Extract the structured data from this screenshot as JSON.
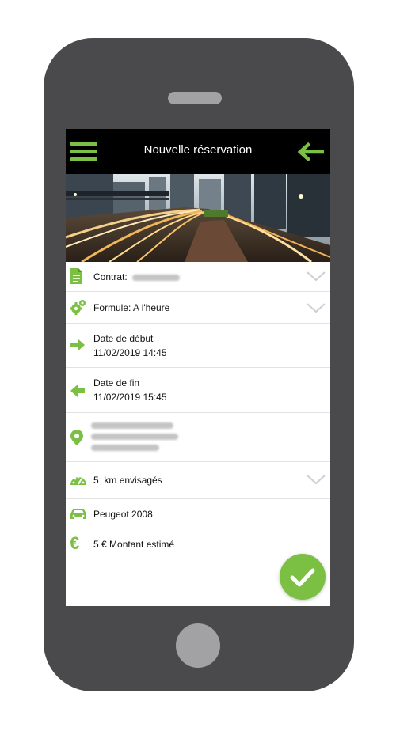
{
  "header": {
    "title": "Nouvelle réservation"
  },
  "form": {
    "contract_label": "Contrat:",
    "formula_label": "Formule:",
    "formula_value": "A l'heure",
    "start_label": "Date de début",
    "start_value": "11/02/2019 14:45",
    "end_label": "Date de fin",
    "end_value": "11/02/2019 15:45",
    "km_value": "5",
    "km_label": "km envisagés",
    "vehicle": "Peugeot 2008",
    "amount_value": "5 €",
    "amount_label": "Montant estimé"
  },
  "colors": {
    "accent": "#7bc043",
    "phone_body": "#4a4a4c",
    "appbar": "#000000"
  },
  "icons": [
    "menu-icon",
    "back-arrow-icon",
    "document-icon",
    "gears-icon",
    "arrow-right-icon",
    "arrow-left-icon",
    "location-pin-icon",
    "speedometer-icon",
    "car-icon",
    "euro-icon",
    "chevron-down-icon",
    "check-icon"
  ]
}
